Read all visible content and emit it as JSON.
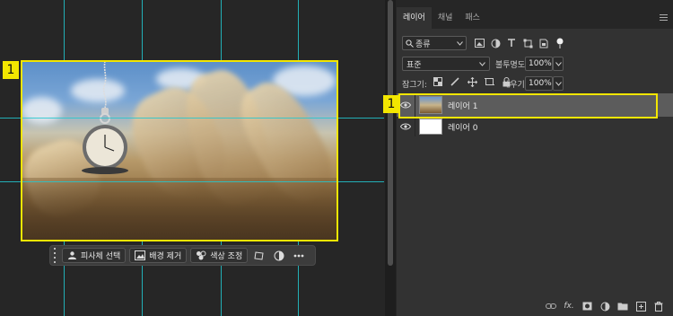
{
  "canvas": {
    "selection_badge": "1",
    "taskbar": {
      "select_subject": "피사체 선택",
      "remove_background": "배경 제거",
      "color_adjust": "색상 조정"
    }
  },
  "panel": {
    "tabs": [
      "레이어",
      "채널",
      "패스"
    ],
    "active_tab": "레이어",
    "filter": {
      "label": "종류"
    },
    "blend_mode": "표준",
    "opacity_label": "불투명도:",
    "opacity_value": "100%",
    "lock_label": "잠그기:",
    "fill_label": "채우기:",
    "fill_value": "100%",
    "layers": [
      {
        "name": "레이어 1",
        "selected": true,
        "badge": "1"
      },
      {
        "name": "레이어 0",
        "selected": false
      }
    ]
  },
  "colors": {
    "guide": "#22c8d0",
    "highlight": "#f3e600",
    "panel_bg": "#323232",
    "canvas_bg": "#262626"
  }
}
